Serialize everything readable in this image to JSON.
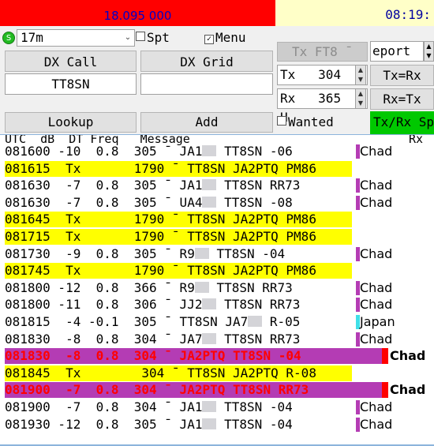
{
  "header": {
    "frequency": "18.095 000",
    "clock": "08:19:"
  },
  "controls": {
    "band": "17m",
    "band_status_glyph": "S",
    "spt_label": "Spt",
    "menu_label": "Menu",
    "spt_checked": false,
    "menu_checked": true,
    "dx_call_label": "DX Call",
    "dx_grid_label": "DX Grid",
    "dx_call_value": "TT8SN",
    "dx_grid_value": "",
    "tx_mode_button": "Tx FT8 ¯",
    "report_label": "eport -",
    "tx_label": "Tx",
    "tx_freq": "304",
    "tx_unit": "H",
    "rx_label": "Rx",
    "rx_freq": "365",
    "rx_unit": "H",
    "tx_eq_rx": "Tx=Rx",
    "rx_eq_tx": "Rx=Tx",
    "lookup": "Lookup",
    "add": "Add",
    "wanted_label": "Wanted",
    "wanted_checked": false,
    "txrx_split": "Tx/Rx Sp"
  },
  "list": {
    "header": "UTC  dB  DT Freq   Message",
    "header_rx": "Rx",
    "rows": [
      {
        "type": "rx",
        "text": "081600 -10  0.8  305 ¯ JA1",
        "blur": true,
        "after": " TT8SN -06",
        "country": "Chad",
        "flag": "chad"
      },
      {
        "type": "tx",
        "text": "081615  Tx       1790 ¯ TT8SN JA2PTQ PM86",
        "blur": false,
        "after": "",
        "country": "",
        "flag": ""
      },
      {
        "type": "rx",
        "text": "081630  -7  0.8  305 ¯ JA1",
        "blur": true,
        "after": " TT8SN RR73",
        "country": "Chad",
        "flag": "chad"
      },
      {
        "type": "rx",
        "text": "081630  -7  0.8  305 ¯ UA4",
        "blur": true,
        "after": " TT8SN -08",
        "country": "Chad",
        "flag": "chad"
      },
      {
        "type": "tx",
        "text": "081645  Tx       1790 ¯ TT8SN JA2PTQ PM86",
        "blur": false,
        "after": "",
        "country": "",
        "flag": ""
      },
      {
        "type": "tx",
        "text": "081715  Tx       1790 ¯ TT8SN JA2PTQ PM86",
        "blur": false,
        "after": "",
        "country": "",
        "flag": ""
      },
      {
        "type": "rx",
        "text": "081730  -9  0.8  305 ¯ R9",
        "blur": true,
        "after": " TT8SN -04",
        "country": "Chad",
        "flag": "chad"
      },
      {
        "type": "tx",
        "text": "081745  Tx       1790 ¯ TT8SN JA2PTQ PM86",
        "blur": false,
        "after": "",
        "country": "",
        "flag": ""
      },
      {
        "type": "rx",
        "text": "081800 -12  0.8  366 ¯ R9",
        "blur": true,
        "after": " TT8SN RR73",
        "country": "Chad",
        "flag": "chad"
      },
      {
        "type": "rx",
        "text": "081800 -11  0.8  306 ¯ JJ2",
        "blur": true,
        "after": " TT8SN RR73",
        "country": "Chad",
        "flag": "chad"
      },
      {
        "type": "rx",
        "text": "081815  -4 -0.1  305 ¯ TT8SN JA7",
        "blur": true,
        "after": " R-05",
        "country": "Japan",
        "flag": "japan"
      },
      {
        "type": "rx",
        "text": "081830  -8  0.8  304 ¯ JA7",
        "blur": true,
        "after": " TT8SN RR73",
        "country": "Chad",
        "flag": "chad"
      },
      {
        "type": "red",
        "text": "081830  -8  0.8  304 ¯ JA2PTQ TT8SN -04",
        "blur": false,
        "after": "",
        "country": "Chad",
        "flag": "red"
      },
      {
        "type": "tx",
        "text": "081845  Tx        304 ¯ TT8SN JA2PTQ R-08",
        "blur": false,
        "after": "",
        "country": "",
        "flag": ""
      },
      {
        "type": "red",
        "text": "081900  -7  0.8  304 ¯ JA2PTQ TT8SN RR73",
        "blur": false,
        "after": "",
        "country": "Chad",
        "flag": "red"
      },
      {
        "type": "rx",
        "text": "081900  -7  0.8  304 ¯ JA1",
        "blur": true,
        "after": " TT8SN -04",
        "country": "Chad",
        "flag": "chad"
      },
      {
        "type": "rx",
        "text": "081930 -12  0.8  305 ¯ JA1",
        "blur": true,
        "after": " TT8SN -04",
        "country": "Chad",
        "flag": "chad"
      }
    ]
  },
  "colors": {
    "tx_highlight": "#ffff00",
    "reply_highlight": "#b43cb4",
    "chad_flag": "#b43cb4",
    "japan_flag": "#40e0e8",
    "split_button": "#00c800",
    "freq_bar": "#ff0000"
  }
}
